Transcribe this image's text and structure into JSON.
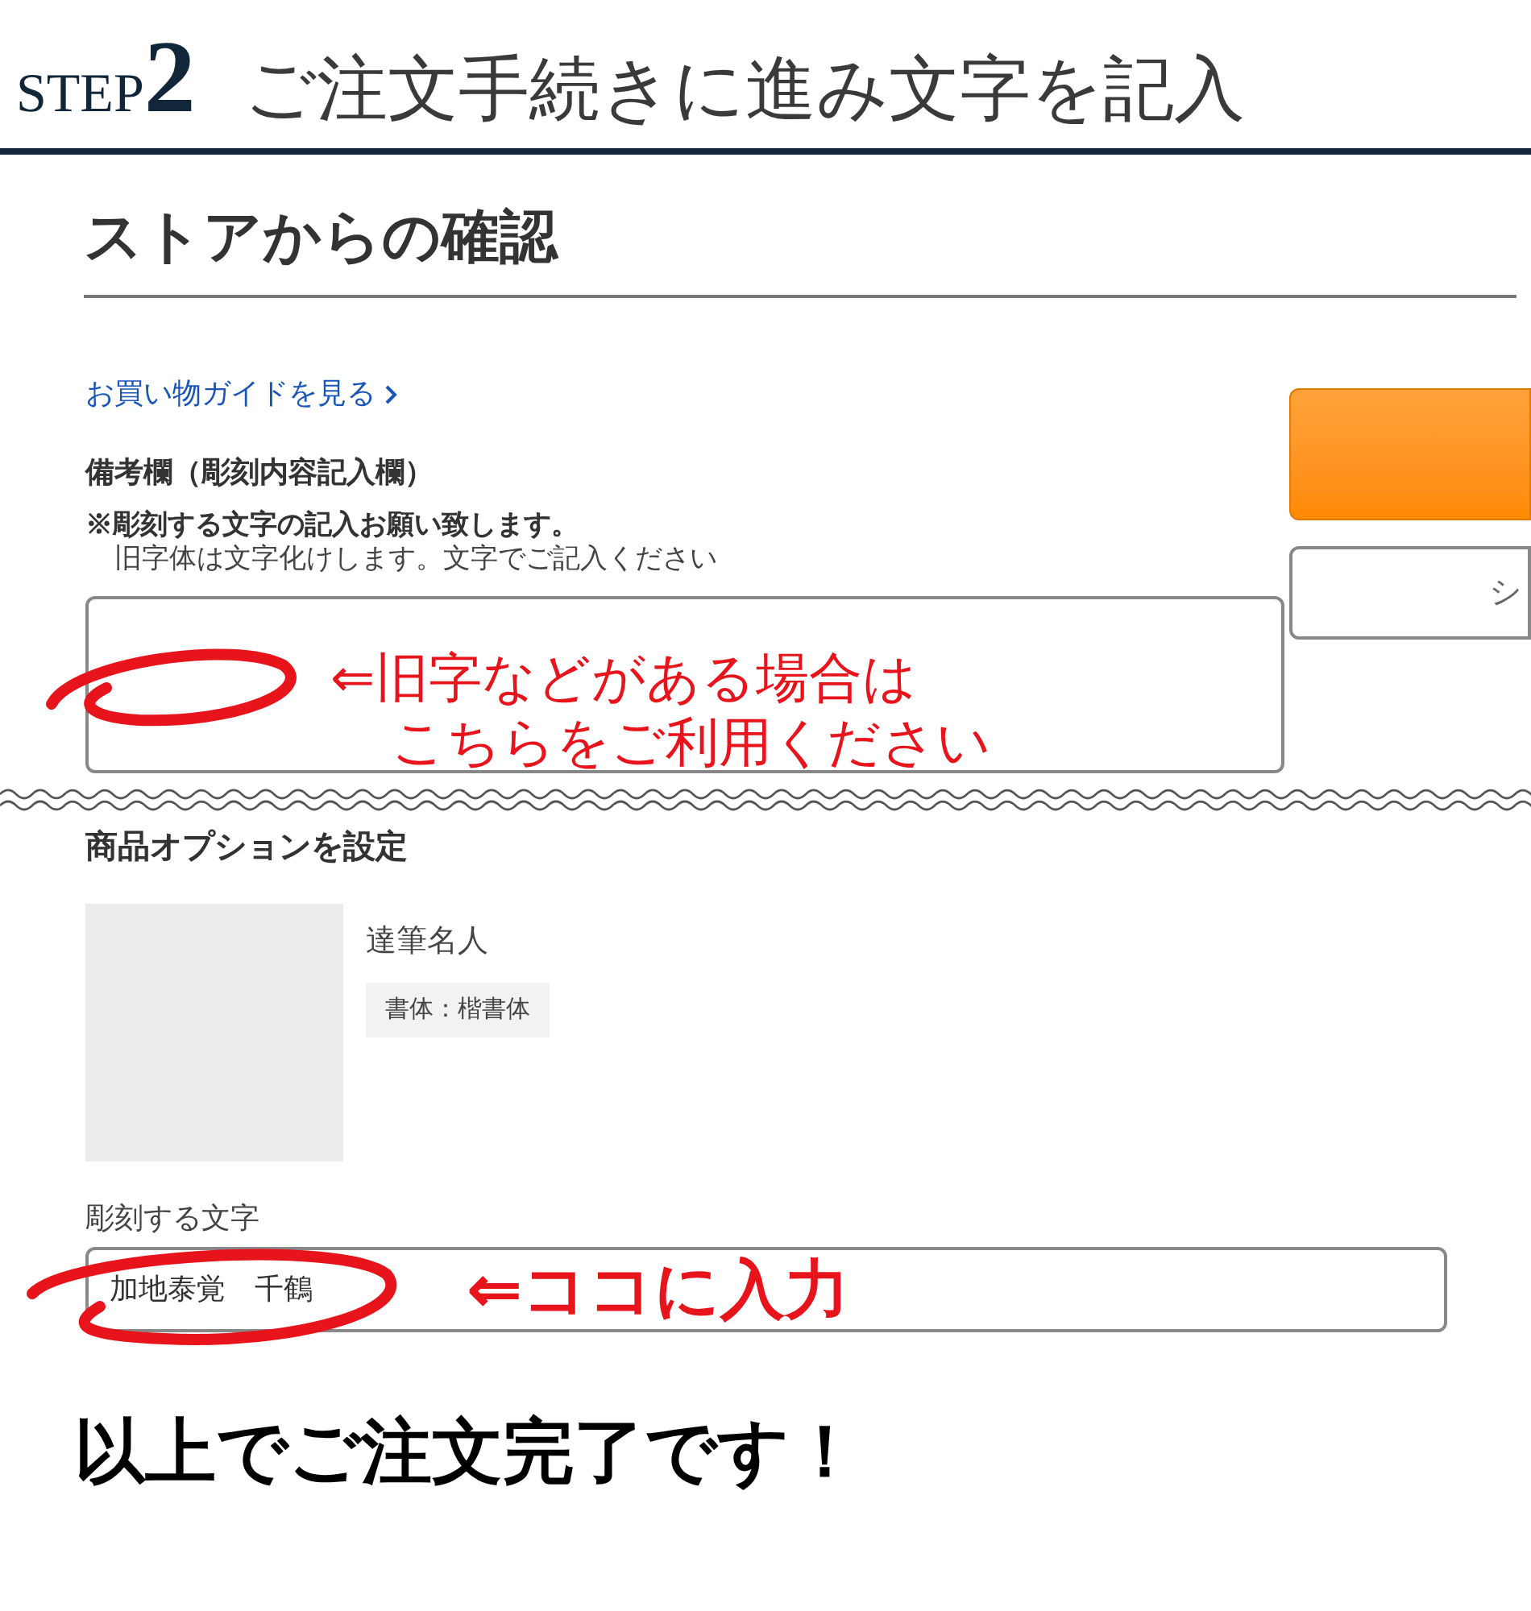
{
  "header": {
    "step_label": "STEP",
    "step_number": "2",
    "title": "ご注文手続きに進み文字を記入"
  },
  "section_title": "ストアからの確認",
  "guide_link": "お買い物ガイドを見る",
  "remarks": {
    "label": "備考欄（彫刻内容記入欄）",
    "note_bold": "※彫刻する文字の記入お願い致します。",
    "note": "旧字体は文字化けします。文字でご記入ください"
  },
  "side_buttons": [
    {
      "kind": "primary"
    },
    {
      "kind": "secondary",
      "label": "シ"
    }
  ],
  "remarks_annotation": [
    "⇐旧字などがある場合は",
    "こちらをご利用ください"
  ],
  "options": {
    "title": "商品オプションを設定",
    "product": {
      "kind": "picture",
      "name": "達筆名人",
      "tag": "書体：楷書体"
    },
    "engraving": {
      "label": "彫刻する文字",
      "value": "加地泰覚　千鶴"
    }
  },
  "engraving_annotation": "⇐ココに入力",
  "footer": "以上でご注文完了です！"
}
